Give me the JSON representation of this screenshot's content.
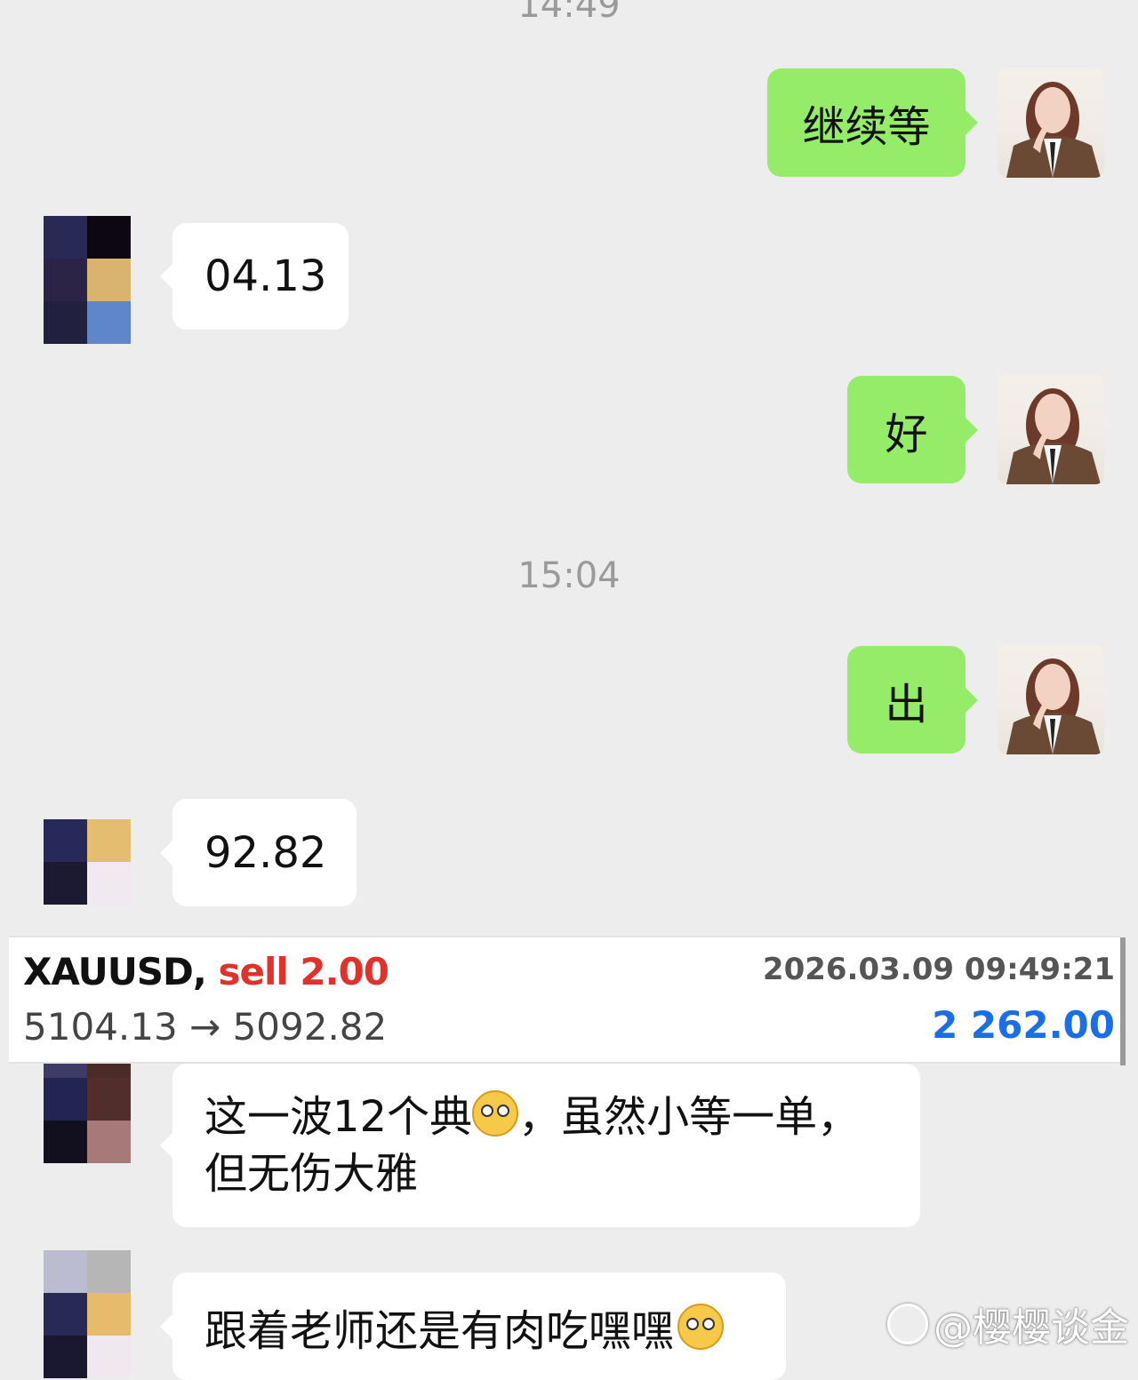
{
  "timestamps": [
    "14:49",
    "15:04"
  ],
  "messages": {
    "m1": "继续等",
    "m2": "04.13",
    "m3": "好",
    "m4": "出",
    "m5": "92.82",
    "m6_part1": "这一波12个典",
    "m6_part2": "，虽然小等一单，",
    "m6_line2": "但无伤大雅",
    "m7": "跟着老师还是有肉吃嘿嘿"
  },
  "trade": {
    "symbol": "XAUUSD,",
    "side": "sell 2.00",
    "datetime": "2026.03.09 09:49:21",
    "prices": "5104.13 → 5092.82",
    "profit": "2 262.00"
  },
  "watermark": "@樱樱谈金",
  "icons": {
    "emoji": "flushed-emoji-icon",
    "watermark_logo": "weibo-logo-icon"
  },
  "avatar_colors": {
    "a1": [
      "#282a55",
      "#0c0710",
      "#2b2446",
      "#d8b46e",
      "#22203f",
      "#5f86c8"
    ],
    "a2": [
      "#27295a",
      "#e4bd70",
      "#1b1a32",
      "#f0eaf0"
    ],
    "a3": [
      "#3e3b66",
      "#4a2b28",
      "#222553",
      "#512e2b",
      "#12101f",
      "#a77a7a"
    ],
    "a4": [
      "#bcbcd0",
      "#b6b6b6",
      "#262a55",
      "#e6bc6c",
      "#191830",
      "#efe9ef"
    ]
  }
}
